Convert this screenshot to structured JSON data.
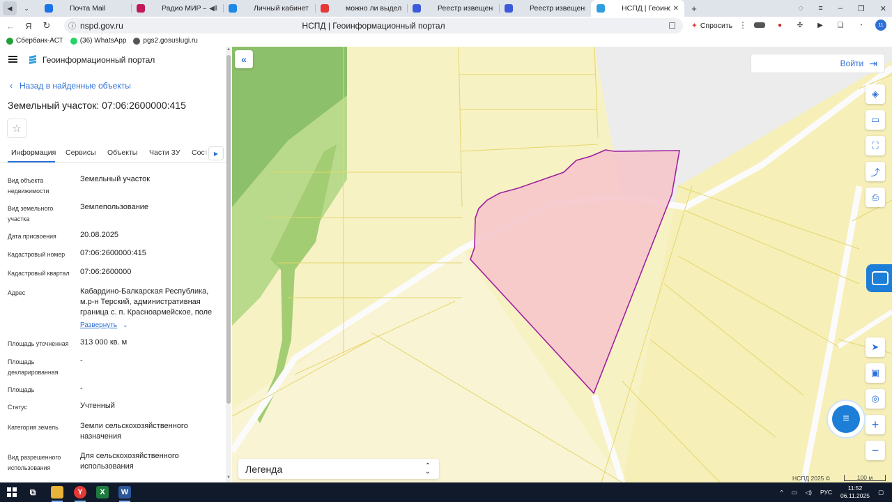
{
  "browser": {
    "tabs": [
      {
        "title": "Почта Mail",
        "color": "#1a73e8",
        "icon": "mail-icon"
      },
      {
        "title": "Радио МИР — слуш",
        "color": "#c2185b",
        "icon": "radio-icon",
        "extra": "◀‖"
      },
      {
        "title": "Личный кабинет",
        "color": "#1e88e5",
        "icon": "cabinet-icon"
      },
      {
        "title": "можно ли выделить доле",
        "color": "#e53935",
        "icon": "search-result-icon"
      },
      {
        "title": "Реестр извещений",
        "color": "#3b5bdb",
        "icon": "registry-icon"
      },
      {
        "title": "Реестр извещений",
        "color": "#3b5bdb",
        "icon": "registry-icon"
      },
      {
        "title": "НСПД | Геоинформац",
        "color": "#2f9ee0",
        "icon": "nspd-icon",
        "active": true
      }
    ],
    "url": "nspd.gov.ru",
    "page_title": "НСПД | Геоинформационный портал",
    "ask_label": "Спросить",
    "bookmarks": [
      {
        "label": "Сбербанк-АСТ",
        "color": "#21a038"
      },
      {
        "label": "(36) WhatsApp",
        "color": "#25d366"
      },
      {
        "label": "pgs2.gosuslugi.ru",
        "color": "#555555"
      }
    ]
  },
  "panel": {
    "portal_title": "Геоинформационный портал",
    "back_label": "Назад в найденные объекты",
    "object_title": "Земельный участок: 07:06:2600000:415",
    "tabs": [
      "Информация",
      "Сервисы",
      "Объекты",
      "Части ЗУ",
      "Соста"
    ],
    "fields": [
      {
        "label": "Вид объекта недвижимости",
        "value": "Земельный участок"
      },
      {
        "label": "Вид земельного участка",
        "value": "Землепользование"
      },
      {
        "label": "Дата присвоения",
        "value": "20.08.2025"
      },
      {
        "label": "Кадастровый номер",
        "value": "07:06:2600000:415"
      },
      {
        "label": "Кадастровый квартал",
        "value": "07:06:2600000"
      },
      {
        "label": "Адрес",
        "value": "Кабардино-Балкарская Республика, м.р-н Терский, административная граница с. п. Красноармейское, поле"
      },
      {
        "label": "Площадь уточненная",
        "value": "313 000 кв. м"
      },
      {
        "label": "Площадь декларированная",
        "value": "-"
      },
      {
        "label": "Площадь",
        "value": "-"
      },
      {
        "label": "Статус",
        "value": "Учтенный"
      },
      {
        "label": "Категория земель",
        "value": "Земли сельскохозяйственного назначения"
      },
      {
        "label": "Вид разрешенного использования",
        "value": "Для сельскохозяйственного использования"
      }
    ],
    "expand_label": "Развернуть"
  },
  "map": {
    "login_label": "Войти",
    "legend_label": "Легенда",
    "copyright": "НСПД 2025 ©",
    "scale": "100 м",
    "colors": {
      "parcel_fill": "#f5c6cb",
      "parcel_stroke": "#a020a0",
      "land": "#f7f2c4",
      "forest": "#8cc06a",
      "road": "#fafafa"
    }
  },
  "taskbar": {
    "lang": "РУС",
    "time": "11:52",
    "date": "06.11.2025"
  }
}
